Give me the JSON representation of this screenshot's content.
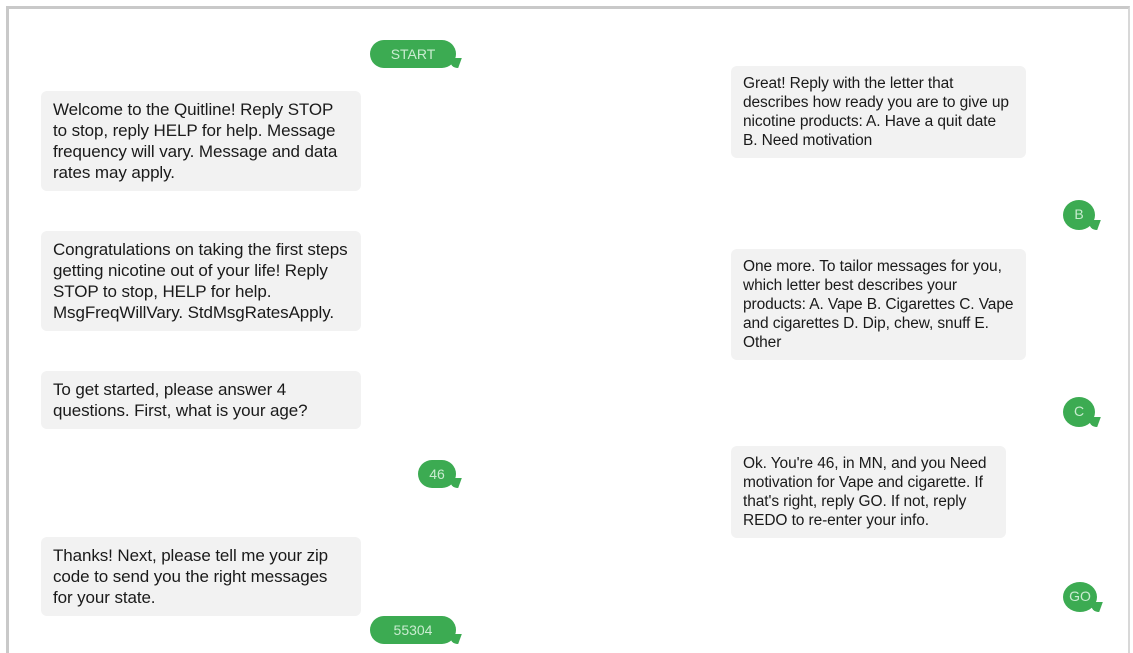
{
  "left_column": {
    "start_reply": "START",
    "welcome": "Welcome to the Quitline! Reply STOP to stop, reply HELP for help. Message frequency will vary. Message and data rates may apply.",
    "congrats": "Congratulations on taking the first steps getting nicotine out of your life! Reply STOP to stop, HELP for help. MsgFreqWillVary. StdMsgRatesApply.",
    "questions": "To get started, please answer 4 questions. First, what is your age?",
    "age_reply": "46",
    "zip_prompt": "Thanks! Next, please tell me your zip code to send you the right messages for your state.",
    "zip_reply": "55304"
  },
  "right_column": {
    "readiness": "Great! Reply with the letter that describes how ready you are to give up nicotine products: A. Have a quit date B. Need motivation",
    "readiness_reply": "B",
    "products": "One more. To tailor messages for you, which letter best describes your products: A. Vape B. Cigarettes C. Vape and cigarettes D. Dip, chew, snuff E. Other",
    "products_reply": "C",
    "confirm": "Ok. You're 46, in MN, and you Need motivation for Vape and cigarette. If that's right, reply GO. If not, reply REDO to re-enter your info.",
    "confirm_reply": "GO"
  },
  "colors": {
    "sent_bubble": "#3cab52",
    "received_bubble": "#f2f2f2"
  }
}
